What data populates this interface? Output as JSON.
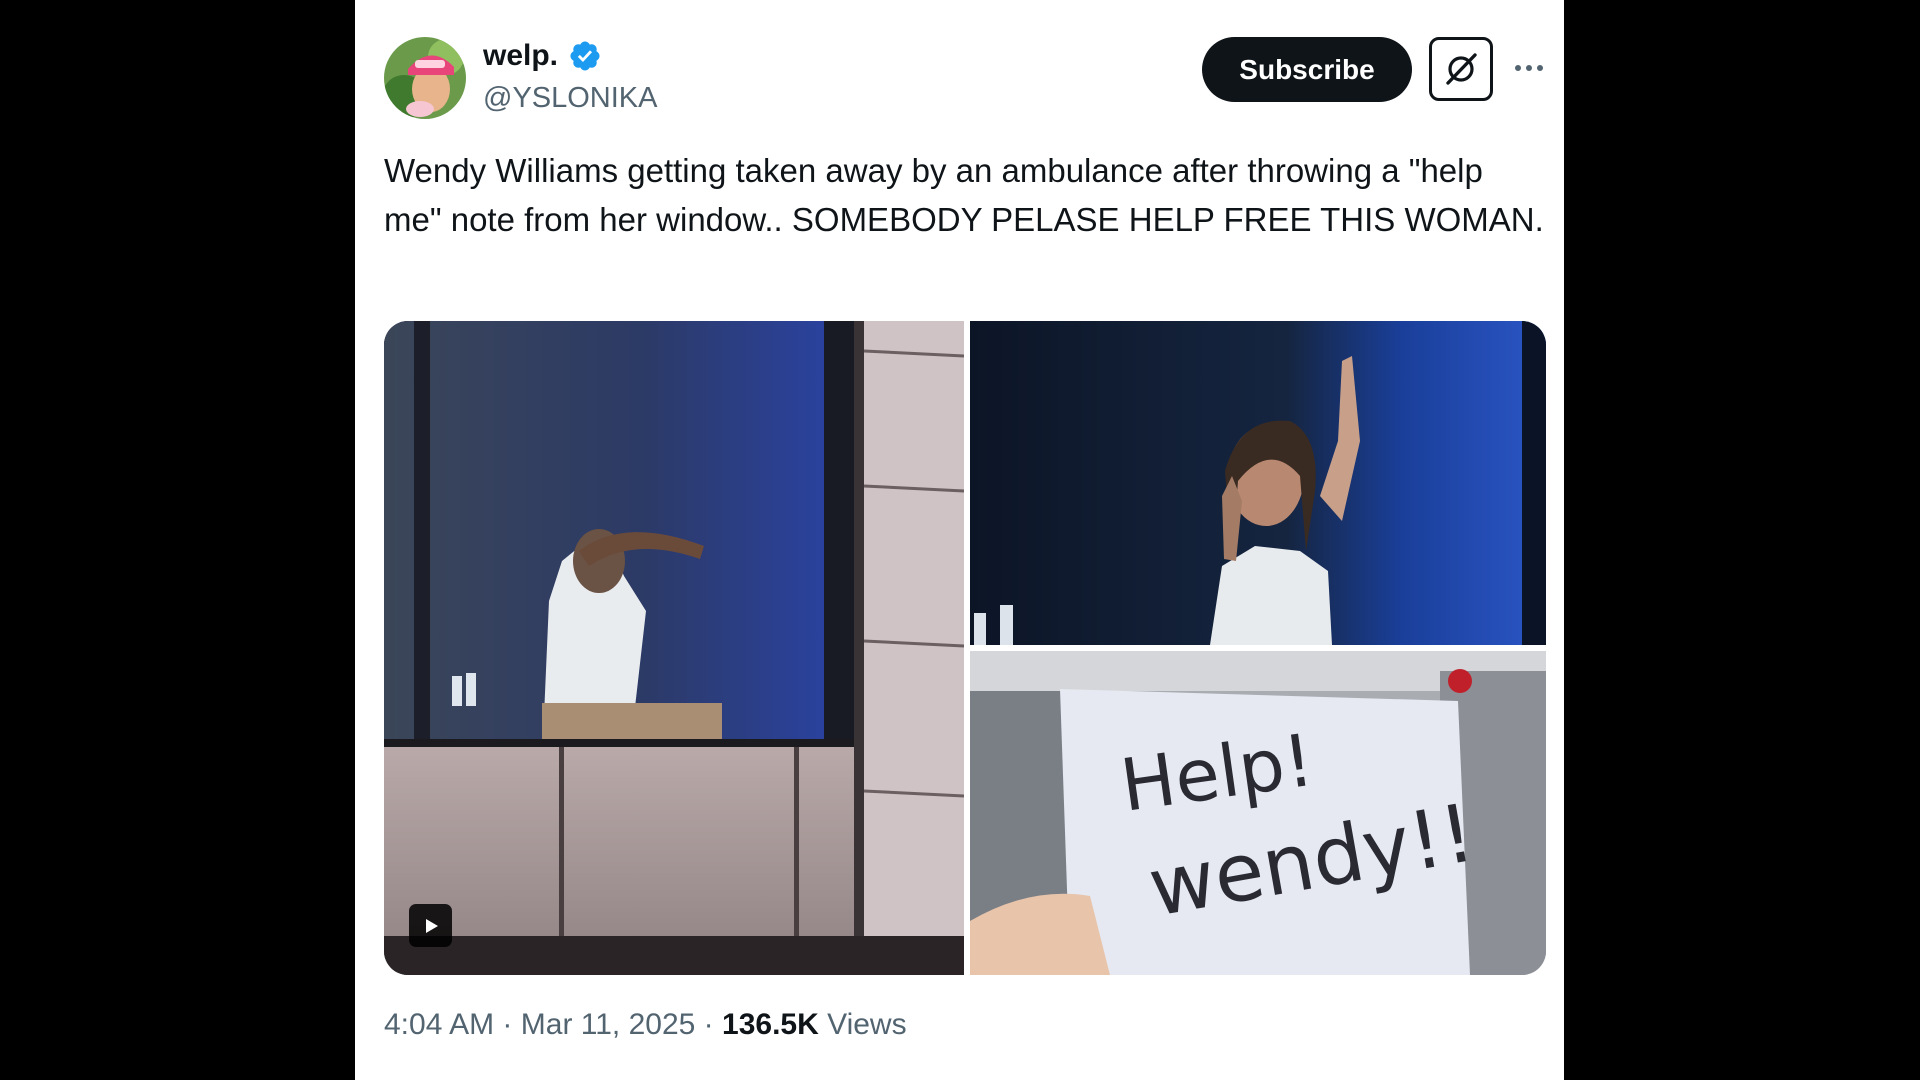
{
  "author": {
    "display_name": "welp.",
    "handle": "@YSLONIKA",
    "avatar_icon": "avatar-image",
    "verified_icon": "verified-badge-icon",
    "verified_color": "#1d9bf0"
  },
  "actions": {
    "subscribe_label": "Subscribe",
    "grok_icon": "grok-icon",
    "more_icon": "more-options-icon"
  },
  "tweet": {
    "text": "Wendy Williams getting taken away by an ambulance after throwing a \"help me\" note from her window.. SOMEBODY PELASE HELP FREE THIS WOMAN.",
    "media": {
      "count": 3,
      "tiles": [
        {
          "name": "video-thumbnail-window",
          "type": "video",
          "play_icon": "play-icon"
        },
        {
          "name": "photo-woman-at-window",
          "type": "image"
        },
        {
          "name": "photo-help-note",
          "type": "image",
          "note_text": "Help! wendy!!"
        }
      ]
    },
    "time": "4:04 AM",
    "date": "Mar 11, 2025",
    "separator": "·",
    "views_count": "136.5K",
    "views_label": "Views"
  },
  "theme": {
    "text_primary": "#0f1419",
    "text_secondary": "#536471",
    "card_background": "#ffffff",
    "page_background": "#000000"
  }
}
